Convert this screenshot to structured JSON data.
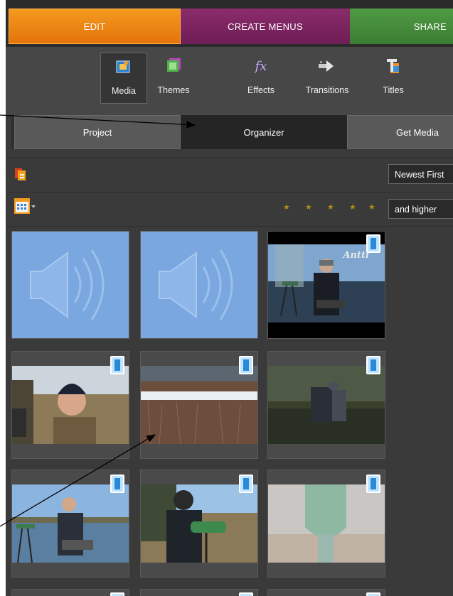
{
  "tabs": {
    "edit": "EDIT",
    "create_menus": "CREATE MENUS",
    "share": "SHARE"
  },
  "toolbar": {
    "media": "Media",
    "themes": "Themes",
    "effects": "Effects",
    "effects_glyph": "fx",
    "transitions": "Transitions",
    "titles": "Titles"
  },
  "subtabs": {
    "project": "Project",
    "organizer": "Organizer",
    "get_media": "Get Media"
  },
  "sort_dropdown": "Newest First",
  "rating_dropdown": "and higher",
  "rating_stars": [
    "★",
    "★",
    "★",
    "★",
    "★"
  ],
  "thumbnail_watermark": "Antti",
  "colors": {
    "edit_tab": "#e8800f",
    "create_menus_tab": "#7d2561",
    "share_tab": "#459038",
    "panel_bg": "#3a3a3a",
    "star": "#b48a18"
  }
}
